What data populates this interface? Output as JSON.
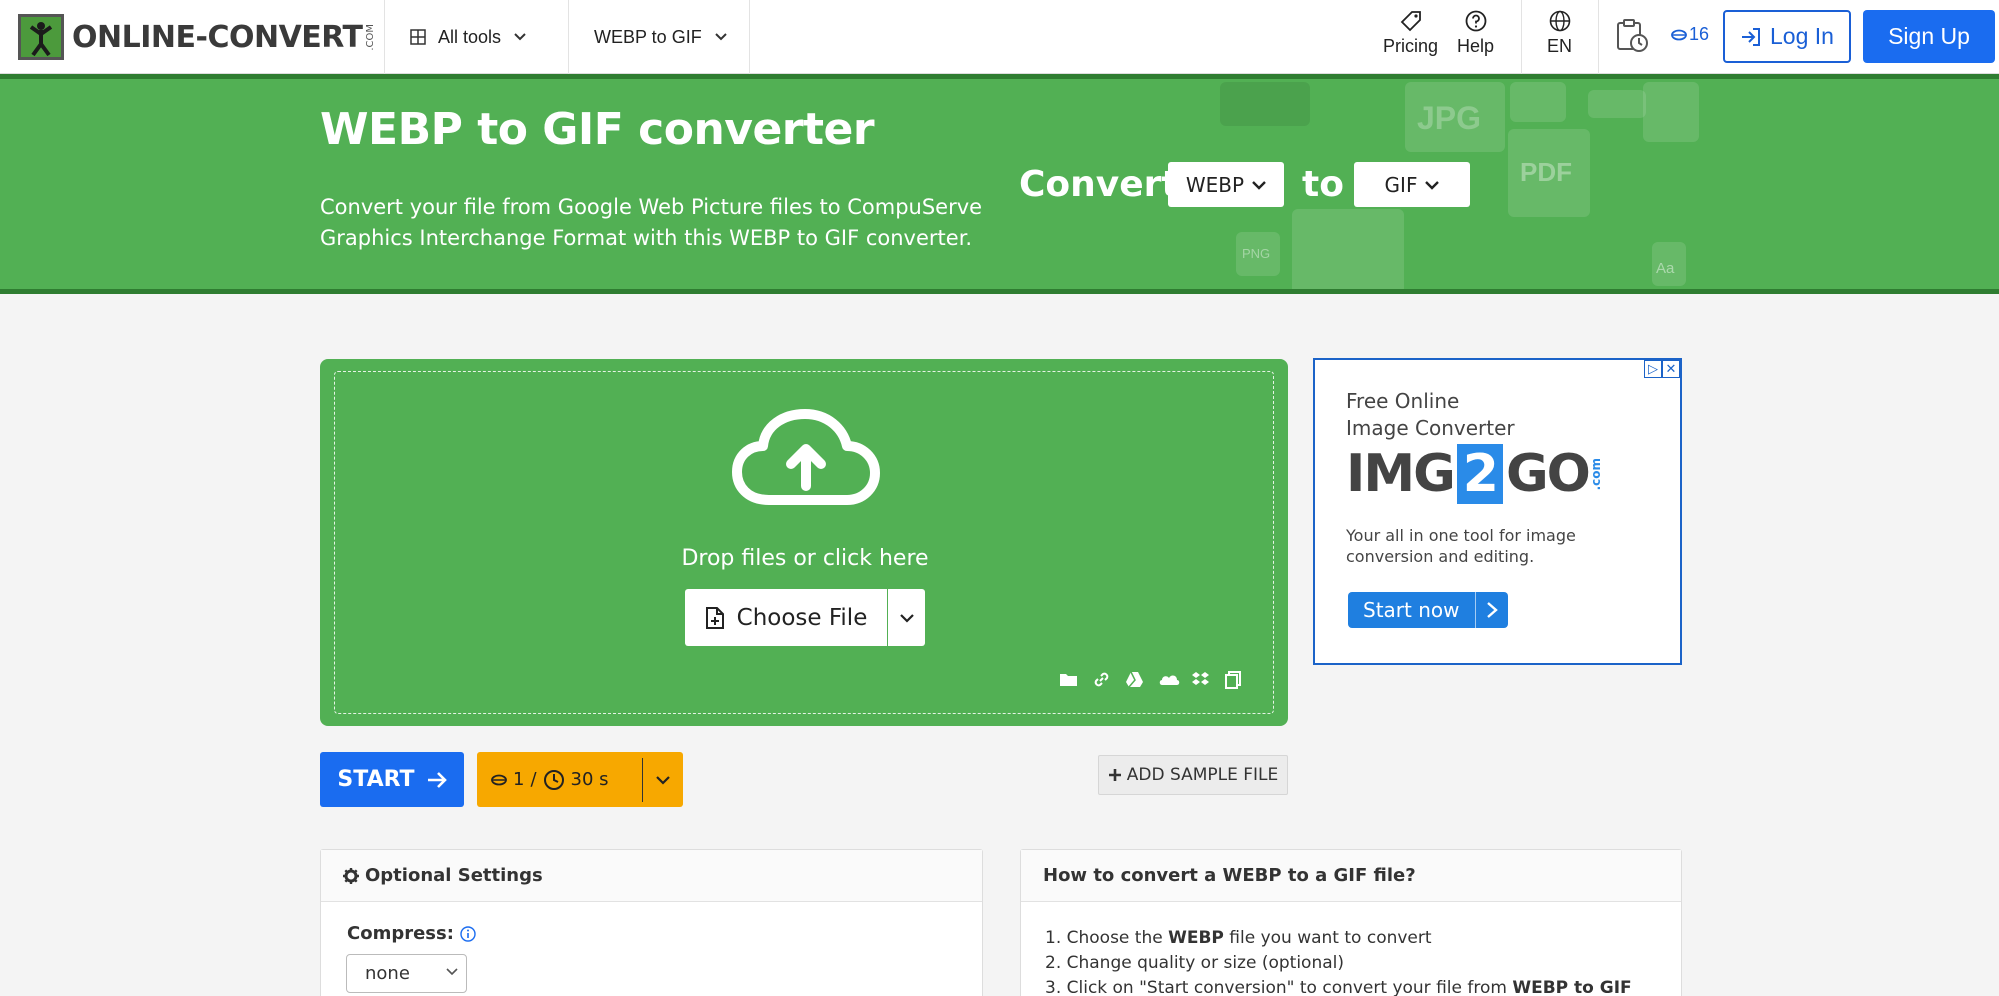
{
  "header": {
    "logo_text_1": "ONLINE-",
    "logo_text_2": "CONVERT",
    "logo_dotcom": ".COM",
    "all_tools": "All tools",
    "current_tool": "WEBP to GIF",
    "pricing": "Pricing",
    "help": "Help",
    "language": "EN",
    "coins": "16",
    "login": "Log In",
    "signup": "Sign Up"
  },
  "banner": {
    "title": "WEBP to GIF converter",
    "description": "Convert your file from Google Web Picture files to CompuServe Graphics Interchange Format with this WEBP to GIF converter.",
    "convert_word": "Convert",
    "from_format": "WEBP",
    "to_word": "to",
    "to_format": "GIF",
    "deco_labels": [
      "JPG",
      "PDF",
      "PNG",
      "Aa"
    ]
  },
  "upload": {
    "drop_text": "Drop files or click here",
    "choose_file": "Choose File",
    "sources": [
      "folder-icon",
      "link-icon",
      "google-drive-icon",
      "onedrive-icon",
      "dropbox-icon",
      "clipboard-icon"
    ]
  },
  "ad": {
    "line1": "Free Online",
    "line2": "Image Converter",
    "brand_a": "IMG",
    "brand_b": "2",
    "brand_c": "GO",
    "brand_dotcom": ".com",
    "sub1": "Your all in one tool for image",
    "sub2": "conversion and editing.",
    "cta": "Start now"
  },
  "actions": {
    "start": "START",
    "credits": "1",
    "slash": "/",
    "seconds": "30 s",
    "add_sample": "ADD SAMPLE FILE"
  },
  "settings": {
    "title": "Optional Settings",
    "compress_label": "Compress:",
    "compress_value": "none"
  },
  "howto": {
    "title": "How to convert a WEBP to a GIF file?",
    "step1_a": "1. Choose the ",
    "step1_b": "WEBP",
    "step1_c": " file you want to convert",
    "step2": "2. Change quality or size (optional)",
    "step3_a": "3. Click on \"Start conversion\" to convert your file from ",
    "step3_b": "WEBP to GIF"
  },
  "colors": {
    "green": "#52b054",
    "blue": "#1a6cf0",
    "orange": "#f7a800"
  }
}
